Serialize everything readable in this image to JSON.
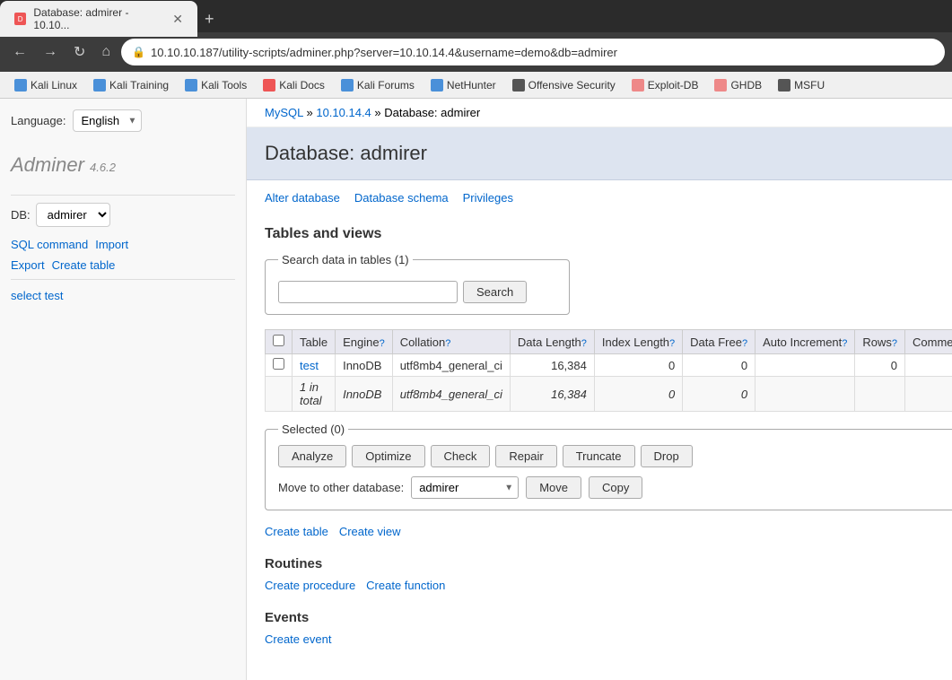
{
  "browser": {
    "tab_title": "Database: admirer - 10.10...",
    "url": "10.10.10.187/utility-scripts/adminer.php?server=10.10.14.4&username=demo&db=admirer",
    "favicon_text": "D"
  },
  "bookmarks": [
    {
      "label": "Kali Linux",
      "icon_class": "bk-kali"
    },
    {
      "label": "Kali Training",
      "icon_class": "bk-training"
    },
    {
      "label": "Kali Tools",
      "icon_class": "bk-tools"
    },
    {
      "label": "Kali Docs",
      "icon_class": "bk-docs"
    },
    {
      "label": "Kali Forums",
      "icon_class": "bk-forums"
    },
    {
      "label": "NetHunter",
      "icon_class": "bk-nethunter"
    },
    {
      "label": "Offensive Security",
      "icon_class": "bk-offsec"
    },
    {
      "label": "Exploit-DB",
      "icon_class": "bk-exploit"
    },
    {
      "label": "GHDB",
      "icon_class": "bk-ghdb"
    },
    {
      "label": "MSFU",
      "icon_class": "bk-msfu"
    }
  ],
  "sidebar": {
    "app_name": "Adminer",
    "app_version": "4.6.2",
    "language_label": "Language:",
    "language_value": "English",
    "db_label": "DB:",
    "db_value": "admirer",
    "links": {
      "sql_command": "SQL command",
      "import": "Import",
      "export": "Export",
      "create_table": "Create table"
    },
    "nav_links": [
      {
        "label": "select test",
        "href": "#"
      }
    ]
  },
  "breadcrumb": {
    "mysql": "MySQL",
    "sep1": "»",
    "ip": "10.10.14.4",
    "sep2": "»",
    "db": "Database: admirer"
  },
  "page_title": "Database: admirer",
  "tab_links": [
    {
      "label": "Alter database"
    },
    {
      "label": "Database schema"
    },
    {
      "label": "Privileges"
    }
  ],
  "tables_section": {
    "title": "Tables and views",
    "search_legend": "Search data in tables (1)",
    "search_placeholder": "",
    "search_btn": "Search",
    "table_headers": [
      {
        "label": "Table",
        "help": ""
      },
      {
        "label": "Engine",
        "help": "?"
      },
      {
        "label": "Collation",
        "help": "?"
      },
      {
        "label": "Data Length",
        "help": "?"
      },
      {
        "label": "Index Length",
        "help": "?"
      },
      {
        "label": "Data Free",
        "help": "?"
      },
      {
        "label": "Auto Increment",
        "help": "?"
      },
      {
        "label": "Rows",
        "help": "?"
      },
      {
        "label": "Comment",
        "help": "?"
      }
    ],
    "rows": [
      {
        "name": "test",
        "engine": "InnoDB",
        "collation": "utf8mb4_general_ci",
        "data_length": "16,384",
        "index_length": "0",
        "data_free": "0",
        "auto_increment": "",
        "rows": "0",
        "comment": ""
      }
    ],
    "total_row": {
      "label": "1 in total",
      "engine": "InnoDB",
      "collation": "utf8mb4_general_ci",
      "data_length": "16,384",
      "index_length": "0",
      "data_free": "0"
    }
  },
  "selected_section": {
    "legend": "Selected (0)",
    "buttons": [
      {
        "label": "Analyze"
      },
      {
        "label": "Optimize"
      },
      {
        "label": "Check"
      },
      {
        "label": "Repair"
      },
      {
        "label": "Truncate"
      },
      {
        "label": "Drop"
      }
    ],
    "move_label": "Move to other database:",
    "move_db_value": "admirer",
    "move_btn": "Move",
    "copy_btn": "Copy"
  },
  "bottom_links": [
    {
      "label": "Create table"
    },
    {
      "label": "Create view"
    }
  ],
  "routines": {
    "title": "Routines",
    "links": [
      {
        "label": "Create procedure"
      },
      {
        "label": "Create function"
      }
    ]
  },
  "events": {
    "title": "Events",
    "links": [
      {
        "label": "Create event"
      }
    ]
  }
}
